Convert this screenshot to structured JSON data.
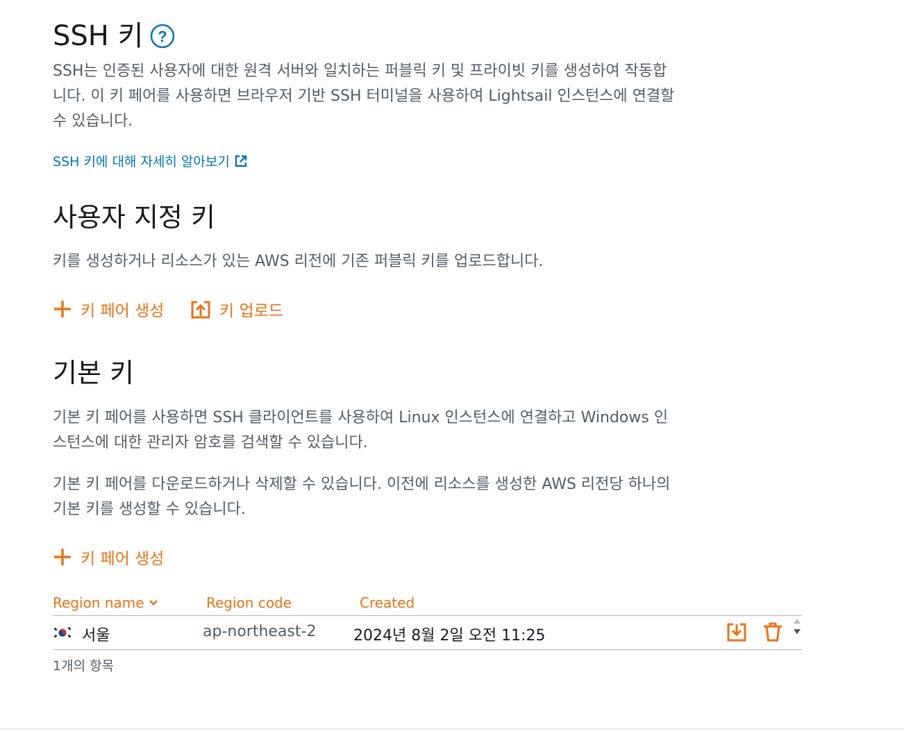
{
  "ssh_section": {
    "title": "SSH 키",
    "description": "SSH는 인증된 사용자에 대한 원격 서버와 일치하는 퍼블릭 키 및 프라이빗 키를 생성하여 작동합니다. 이 키 페어를 사용하면 브라우저 기반 SSH 터미널을 사용하여 Lightsail 인스턴스에 연결할 수 있습니다.",
    "learn_more": "SSH 키에 대해 자세히 알아보기"
  },
  "custom_keys": {
    "title": "사용자 지정 키",
    "description": "키를 생성하거나 리소스가 있는 AWS 리전에 기존 퍼블릭 키를 업로드합니다.",
    "create_label": "키 페어 생성",
    "upload_label": "키 업로드"
  },
  "default_keys": {
    "title": "기본 키",
    "description1": "기본 키 페어를 사용하면 SSH 클라이언트를 사용하여 Linux 인스턴스에 연결하고 Windows 인스턴스에 대한 관리자 암호를 검색할 수 있습니다.",
    "description2": "기본 키 페어를 다운로드하거나 삭제할 수 있습니다. 이전에 리소스를 생성한 AWS 리전당 하나의 기본 키를 생성할 수 있습니다.",
    "create_label": "키 페어 생성"
  },
  "table": {
    "headers": {
      "region_name": "Region name",
      "region_code": "Region code",
      "created": "Created"
    },
    "rows": [
      {
        "region_name": "서울",
        "region_code": "ap-northeast-2",
        "created": "2024년 8월 2일 오전 11:25"
      }
    ],
    "count": "1개의 항목"
  },
  "colors": {
    "accent": "#ec7211",
    "link": "#0073bb",
    "heading": "#16191f",
    "body": "#545b64"
  }
}
